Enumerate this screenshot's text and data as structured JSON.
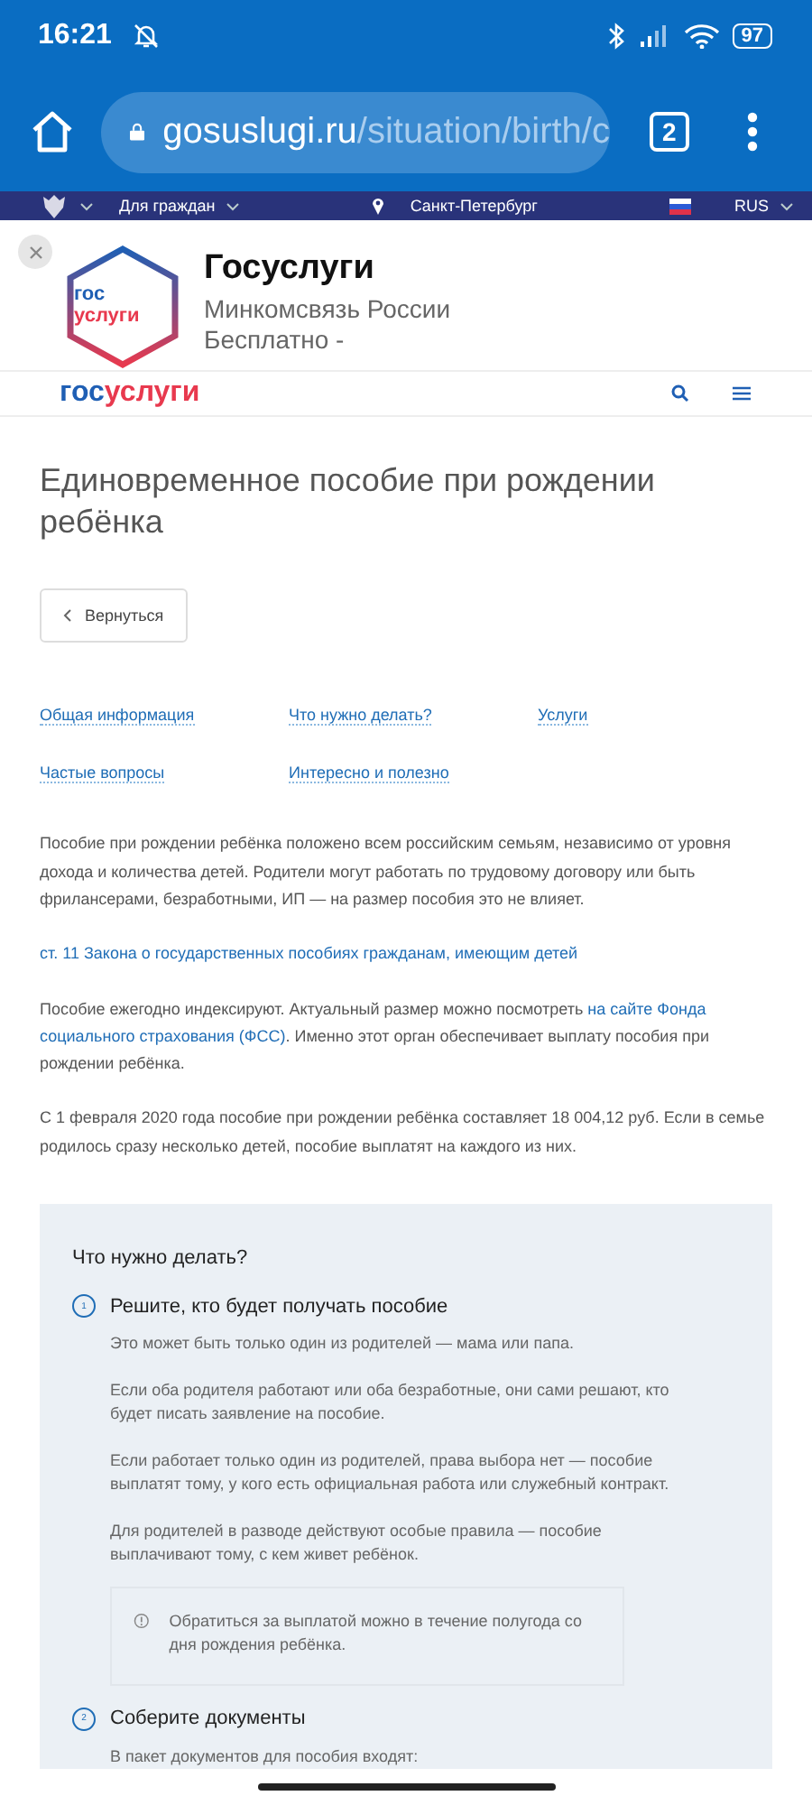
{
  "status_bar": {
    "time": "16:21",
    "battery": "97"
  },
  "browser": {
    "url_host": "gosuslugi.ru",
    "url_path": "/situation/birth/c",
    "tab_count": "2"
  },
  "gov_bar": {
    "menu": "Для граждан",
    "location": "Санкт-Петербург",
    "language": "RUS"
  },
  "app_banner": {
    "title": "Госуслуги",
    "publisher": "Минкомсвязь России",
    "price": "Бесплатно -",
    "logo_top": "гос",
    "logo_bottom": "услуги"
  },
  "site_header": {
    "logo_left": "гос",
    "logo_right": "услуги"
  },
  "page_title": "Единовременное пособие при рождении ребёнка",
  "back_button": "Вернуться",
  "anchors": [
    [
      "Общая информация",
      "Что нужно делать?",
      "Услуги"
    ],
    [
      "Частые вопросы",
      "Интересно и полезно"
    ]
  ],
  "paragraphs": [
    {
      "kind": "text",
      "parts": [
        {
          "text": "Пособие при рождении ребёнка положено всем российским семьям, независимо от уровня дохода и количества детей. Родители могут работать по трудовому договору или быть фрилансерами, безработными, ИП — на размер пособия это не влияет.",
          "link": false
        }
      ]
    },
    {
      "kind": "link",
      "parts": [
        {
          "text": "ст. 11 Закона о государственных пособиях гражданам, имеющим детей",
          "link": true
        }
      ]
    },
    {
      "kind": "text",
      "parts": [
        {
          "text": "Пособие ежегодно индексируют. Актуальный размер можно посмотреть ",
          "link": false
        },
        {
          "text": "на сайте Фонда",
          "link": true
        },
        {
          "text": "социального страхования (ФСС)",
          "link": true
        },
        {
          "text": ". Именно этот орган обеспечивает выплату пособия при рождении ребёнка.",
          "link": false
        }
      ]
    },
    {
      "kind": "text",
      "parts": [
        {
          "text": "С 1 февраля 2020 года пособие при рождении ребёнка составляет 18 004,12 руб. Если в семье родилось сразу несколько детей, пособие выплатят на каждого из них.",
          "link": false
        }
      ]
    }
  ],
  "steps_panel": {
    "title": "Что нужно делать?",
    "steps": [
      {
        "number": "1",
        "title": "Решите, кто будет получать пособие",
        "paragraphs": [
          "Это может быть только один из родителей — мама или папа.",
          "Если оба родителя работают или оба безработные, они сами решают, кто будет писать заявление на пособие.",
          "Если работает только один из родителей, права выбора нет — пособие выплатят тому, у кого есть официальная работа или служебный контракт.",
          "Для родителей в разводе действуют особые правила — пособие выплачивают тому, с кем живет ребёнок."
        ],
        "note": "Обратиться за выплатой можно в течение полугода со дня рождения ребёнка."
      },
      {
        "number": "2",
        "title": "Соберите документы",
        "paragraphs": [
          "В пакет документов для пособия входят:"
        ]
      }
    ]
  }
}
